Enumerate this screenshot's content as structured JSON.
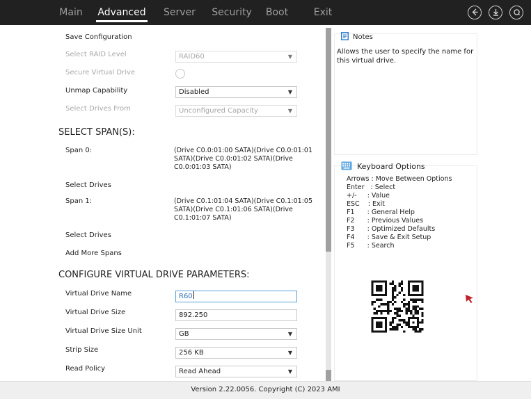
{
  "nav": {
    "tabs": [
      {
        "label": "Main"
      },
      {
        "label": "Advanced"
      },
      {
        "label": "Server"
      },
      {
        "label": "Security"
      },
      {
        "label": "Boot"
      },
      {
        "label": "Exit"
      }
    ],
    "active_tab": "Advanced",
    "icons": [
      "back-circle-icon",
      "download-circle-icon",
      "search-circle-icon"
    ]
  },
  "form": {
    "save_configuration": "Save Configuration",
    "select_raid_level": {
      "label": "Select RAID Level",
      "value": "RAID60",
      "disabled": true
    },
    "secure_virtual_drive": {
      "label": "Secure Virtual Drive",
      "disabled": true
    },
    "unmap_capability": {
      "label": "Unmap Capability",
      "value": "Disabled"
    },
    "select_drives_from": {
      "label": "Select Drives From",
      "value": "Unconfigured Capacity",
      "disabled": true
    },
    "select_spans_heading": "SELECT SPAN(S):",
    "span0": {
      "label": "Span 0:",
      "drives": "(Drive C0.0:01:00 SATA)(Drive C0.0:01:01 SATA)(Drive C0.0:01:02 SATA)(Drive C0.0:01:03 SATA)"
    },
    "select_drives_0": "Select Drives",
    "span1": {
      "label": "Span 1:",
      "drives": "(Drive C0.1:01:04 SATA)(Drive C0.1:01:05 SATA)(Drive C0.1:01:06 SATA)(Drive C0.1:01:07 SATA)"
    },
    "select_drives_1": "Select Drives",
    "add_more_spans": "Add More Spans",
    "configure_heading": "CONFIGURE VIRTUAL DRIVE PARAMETERS:",
    "virtual_drive_name": {
      "label": "Virtual Drive Name",
      "value": "R60"
    },
    "virtual_drive_size": {
      "label": "Virtual Drive Size",
      "value": "892.250"
    },
    "virtual_drive_size_unit": {
      "label": "Virtual Drive Size Unit",
      "value": "GB"
    },
    "strip_size": {
      "label": "Strip Size",
      "value": "256 KB"
    },
    "read_policy": {
      "label": "Read Policy",
      "value": "Read Ahead"
    }
  },
  "notes": {
    "title": "Notes",
    "text": "Allows the user to specify the name for this virtual drive."
  },
  "keyboard": {
    "title": "Keyboard Options",
    "lines": [
      "Arrows : Move Between Options",
      "Enter   : Select",
      "+/-     : Value",
      "ESC    : Exit",
      "F1      : General Help",
      "F2      : Previous Values",
      "F3      : Optimized Defaults",
      "F4      : Save & Exit Setup",
      "F5      : Search"
    ]
  },
  "footer": {
    "text": "Version 2.22.0056. Copyright (C) 2023 AMI"
  },
  "colors": {
    "topbar": "#212121",
    "tab_inactive": "#9e9e9e",
    "tab_active": "#ffffff",
    "focus_border": "#5a9fd4",
    "cursor_red": "#c0202a"
  }
}
